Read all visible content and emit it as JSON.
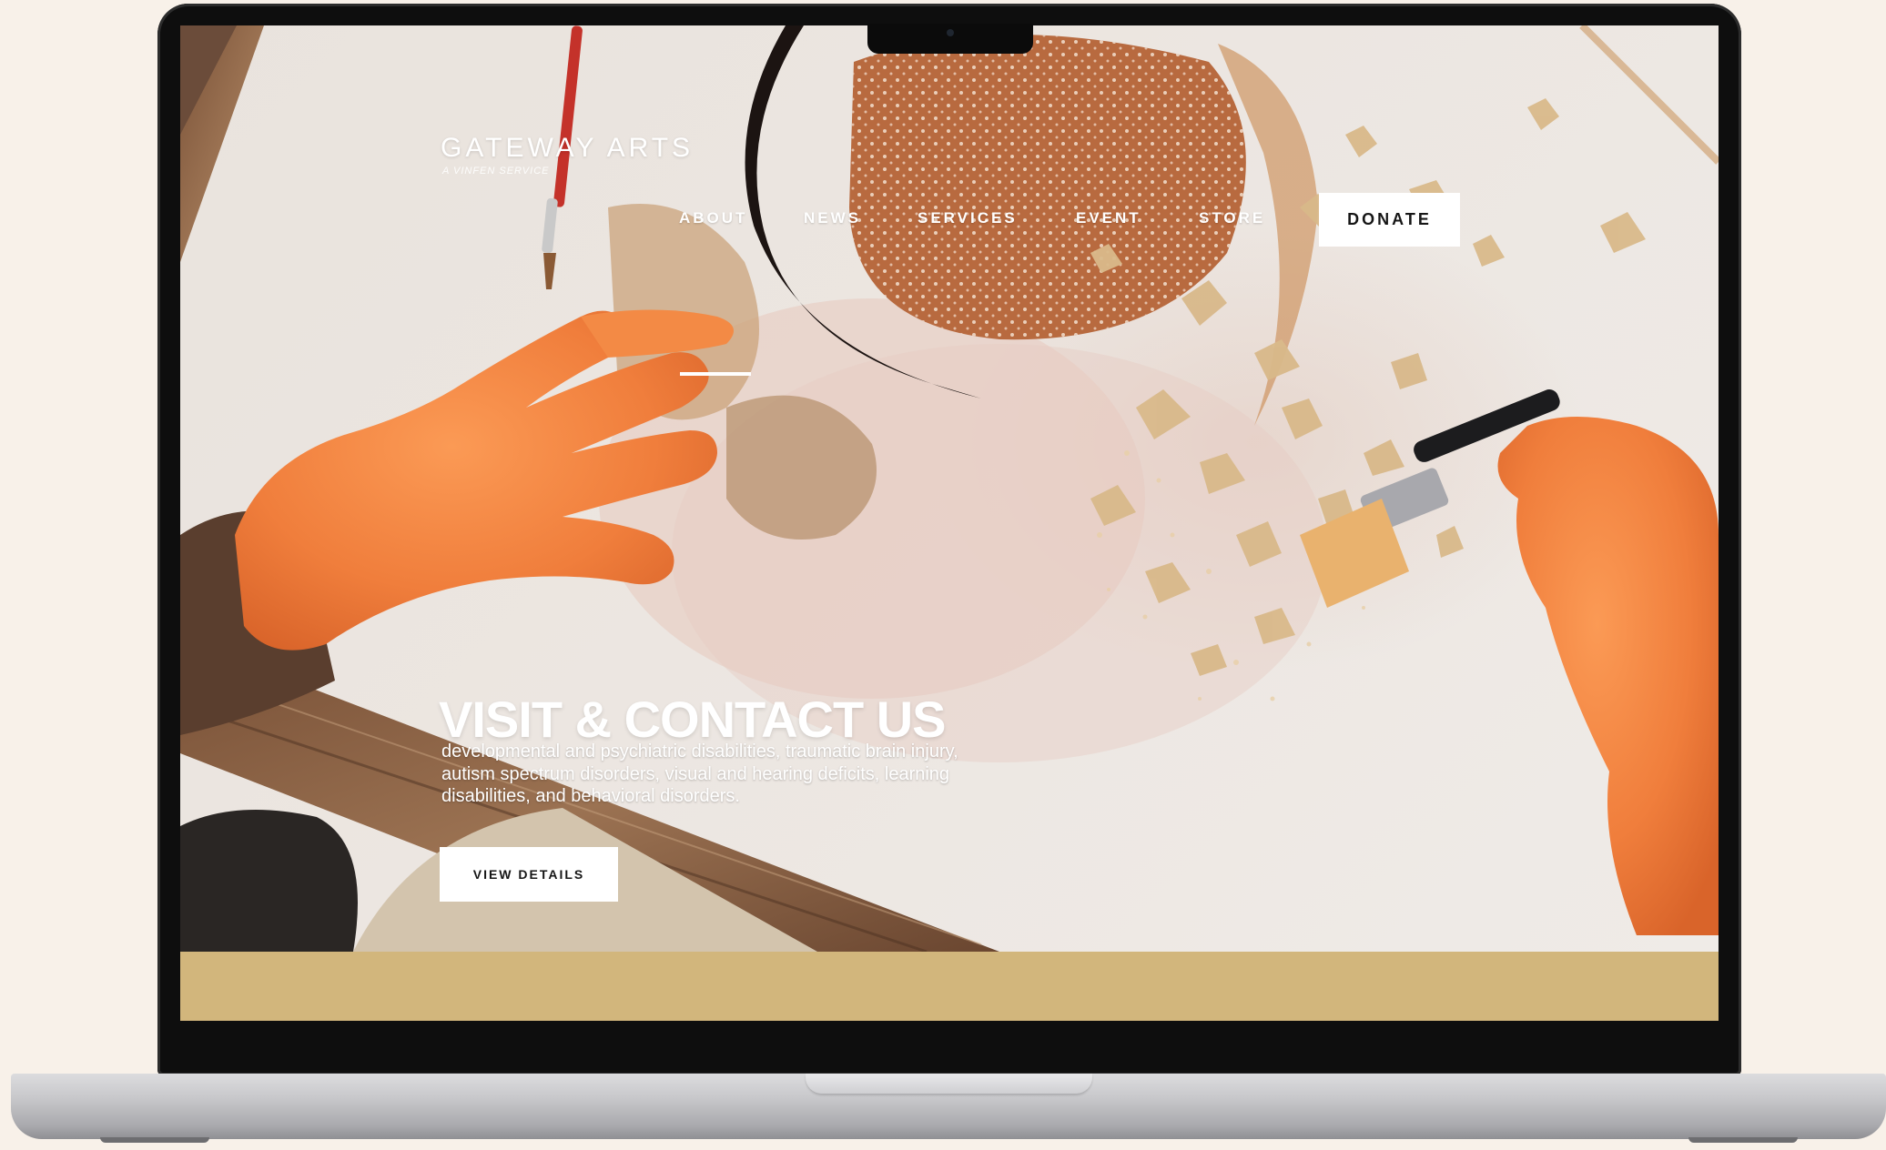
{
  "site": {
    "brand": "GATEWAY ARTS",
    "brand_sub": "A VINFEN SERVICE"
  },
  "nav": {
    "items": [
      {
        "label": "ABOUT"
      },
      {
        "label": "NEWS"
      },
      {
        "label": "SERVICES"
      },
      {
        "label": "EVENT"
      },
      {
        "label": "STORE"
      }
    ],
    "donate_label": "DONATE"
  },
  "hero": {
    "headline": "VISIT & CONTACT US",
    "body": "developmental and psychiatric disabilities, traumatic brain injury, autism spectrum disorders, visual and hearing deficits, learning disabilities, and behavioral disorders.",
    "cta_label": "VIEW DETAILS"
  },
  "colors": {
    "page_background": "#f8f1e9",
    "laptop_bezel": "#0e0e0e",
    "laptop_base": "#c9c9cc",
    "gold_band": "#d2b67c",
    "glove_orange": "#f07e3c",
    "button_bg": "#ffffff",
    "button_text": "#161616"
  }
}
